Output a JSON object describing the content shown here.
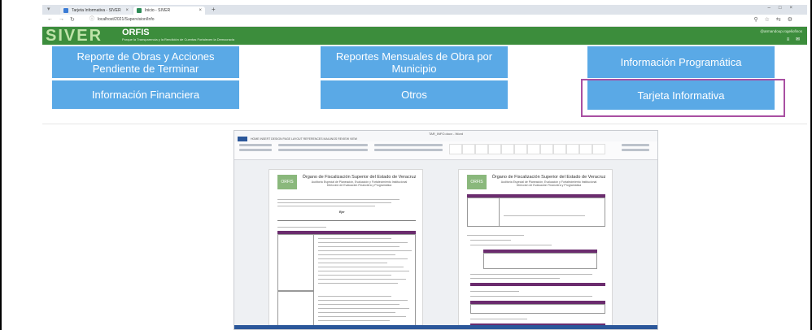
{
  "browser": {
    "tabs": [
      {
        "label": "Tarjeta Informativa - SIVER"
      },
      {
        "label": "Inicio - SIVER"
      }
    ],
    "new_tab": "+",
    "url": "localhost/2021/Supervision/Info"
  },
  "header": {
    "logo_main": "SIVER",
    "logo_org": "ORFIS",
    "subtitle": "Porque la Transparencia y la Rendición de Cuentas Fortalecen la Democracia",
    "user": "@armandoup.rogeliofinos"
  },
  "menu": {
    "tiles": [
      {
        "label": "Reporte de Obras y Acciones Pendiente de Terminar"
      },
      {
        "label": "Reportes Mensuales de Obra por Municipio"
      },
      {
        "label": "Información Programática"
      },
      {
        "label": "Información Financiera"
      },
      {
        "label": "Otros"
      },
      {
        "label": "Tarjeta Informativa"
      }
    ]
  },
  "document": {
    "window_title": "TAR_INFO.docx - Word",
    "ribbon_tabs": "HOME   INSERT   DESIGN   PAGE LAYOUT   REFERENCES   MAILINGS   REVIEW   VIEW",
    "logo": "ORFIS",
    "org_title": "Órgano de Fiscalización Superior del Estado de Veracruz",
    "org_sub1": "Auditoría Especial de Planeación, Evaluación y Fortalecimiento Institucional",
    "org_sub2": "Dirección de Evaluación Financiera y Programática",
    "letter": "Ejer"
  },
  "colors": {
    "header_green": "#3c8d3c",
    "tile_blue": "#5aa9e6",
    "selected_border": "#a94fa2",
    "doc_table_header": "#6b2c6e"
  }
}
